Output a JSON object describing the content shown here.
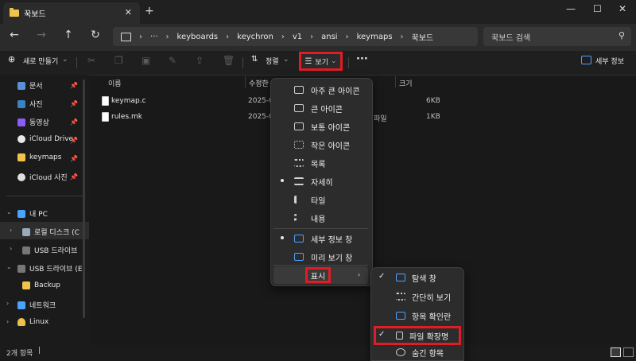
{
  "window": {
    "tab_title": "꾹보드",
    "close_glyph": "✕",
    "new_tab_glyph": "+",
    "minimize_glyph": "—",
    "maximize_glyph": "☐",
    "close_window_glyph": "✕"
  },
  "nav": {
    "back_glyph": "←",
    "forward_glyph": "→",
    "up_glyph": "↑",
    "refresh_glyph": "↻"
  },
  "address": {
    "breadcrumbs": [
      "keyboards",
      "keychron",
      "v1",
      "ansi",
      "keymaps",
      "꾹보드"
    ],
    "ellipsis": "···",
    "sep": "›"
  },
  "search": {
    "placeholder": "꾹보드 검색"
  },
  "toolbar": {
    "new_label": "새로 만들기",
    "sort_label": "정렬",
    "view_label": "보기",
    "more_glyph": "···",
    "details_label": "세부 정보"
  },
  "sidebar": {
    "quick": [
      {
        "label": "문서",
        "color": "#5b8fd6"
      },
      {
        "label": "사진",
        "color": "#3b82c4"
      },
      {
        "label": "동영상",
        "color": "#8b5cf6"
      },
      {
        "label": "iCloud Drive",
        "color": "#e8e8e8"
      },
      {
        "label": "keymaps",
        "color": "#f0c44c"
      },
      {
        "label": "iCloud 사진",
        "color": "#e0e0e0"
      }
    ],
    "tree": [
      {
        "label": "내 PC"
      },
      {
        "label": "로컬 디스크 (C"
      },
      {
        "label": "USB 드라이브"
      },
      {
        "label": "USB 드라이브 (E"
      },
      {
        "label": "Backup"
      },
      {
        "label": "네트워크"
      },
      {
        "label": "Linux"
      }
    ]
  },
  "list": {
    "headers": {
      "name": "이름",
      "date": "수정한",
      "size": "크기"
    },
    "rows": [
      {
        "name": "keymap.c",
        "date": "2025-0",
        "type": "",
        "size": "6KB"
      },
      {
        "name": "rules.mk",
        "date": "2025-0",
        "type": "파일",
        "size": "1KB"
      }
    ]
  },
  "view_menu": {
    "items": [
      {
        "label": "아주 큰 아이콘",
        "bullet": false
      },
      {
        "label": "큰 아이콘",
        "bullet": false
      },
      {
        "label": "보통 아이콘",
        "bullet": false
      },
      {
        "label": "작은 아이콘",
        "bullet": false
      },
      {
        "label": "목록",
        "bullet": false
      },
      {
        "label": "자세히",
        "bullet": true
      },
      {
        "label": "타일",
        "bullet": false
      },
      {
        "label": "내용",
        "bullet": false
      }
    ],
    "panes": [
      {
        "label": "세부 정보 창",
        "bullet": true
      },
      {
        "label": "미리 보기 창",
        "bullet": false
      }
    ],
    "show_label": "표시",
    "submenu_arrow": "›"
  },
  "show_submenu": {
    "items": [
      {
        "label": "탐색 창",
        "checked": true
      },
      {
        "label": "간단히 보기",
        "checked": false
      },
      {
        "label": "항목 확인란",
        "checked": false
      },
      {
        "label": "파일 확장명",
        "checked": true
      },
      {
        "label": "숨긴 항목",
        "checked": false
      }
    ],
    "check_glyph": "✓"
  },
  "status": {
    "item_count": "2개 항목"
  },
  "colors": {
    "highlight": "#e01c24"
  }
}
